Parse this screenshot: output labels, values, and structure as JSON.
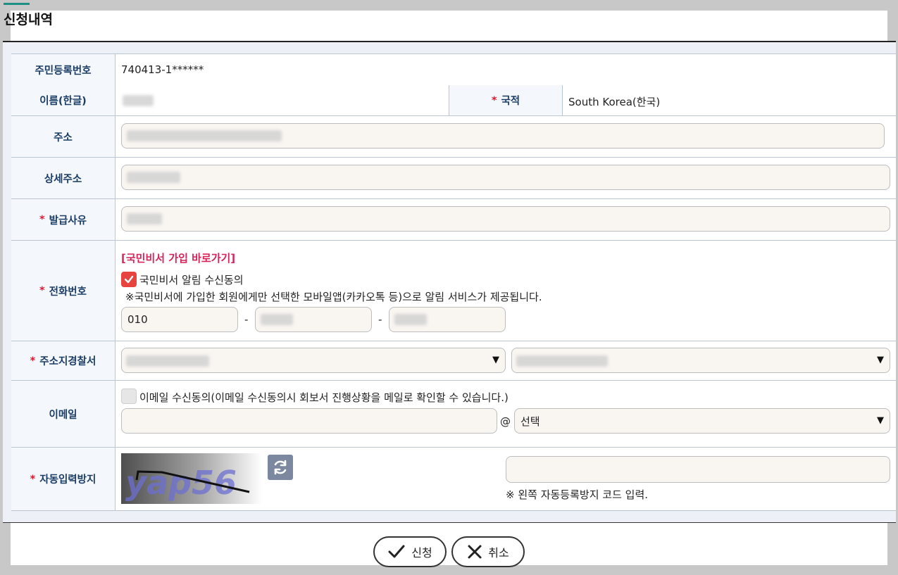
{
  "page": {
    "title": "신청내역"
  },
  "form": {
    "rrn": {
      "label": "주민등록번호",
      "value": "740413-1******"
    },
    "name": {
      "label": "이름(한글)"
    },
    "nationality": {
      "required": "*",
      "label": "국적",
      "value": "South Korea(한국)"
    },
    "address": {
      "label": "주소"
    },
    "detail_address": {
      "label": "상세주소"
    },
    "issue_reason": {
      "required": "*",
      "label": "발급사유"
    },
    "phone": {
      "required": "*",
      "label": "전화번호",
      "link": "[국민비서 가입 바로가기]",
      "consent_label": "국민비서 알림 수신동의",
      "consent_checked": true,
      "note": "※국민비서에 가입한 회원에게만 선택한 모바일앱(카카오톡 등)으로 알림 서비스가 제공됩니다.",
      "part1": "010",
      "dash": "-"
    },
    "police": {
      "required": "*",
      "label": "주소지경찰서",
      "arrow": "▼"
    },
    "email": {
      "label": "이메일",
      "consent_label": "이메일 수신동의(이메일 수신동의시 회보서 진행상황을 메일로 확인할 수 있습니다.)",
      "consent_checked": false,
      "at": "@",
      "domain_value": "선택",
      "arrow": "▼"
    },
    "captcha": {
      "required": "*",
      "label": "자동입력방지",
      "image_text": "yap56",
      "note": "※ 왼쪽 자동등록방지 코드 입력."
    }
  },
  "buttons": {
    "submit": "신청",
    "cancel": "취소"
  },
  "colors": {
    "accent": "#1e8f85",
    "required": "#e0172f",
    "link": "#d6245a",
    "label": "#1b3d66",
    "checkbox": "#e8443f"
  }
}
